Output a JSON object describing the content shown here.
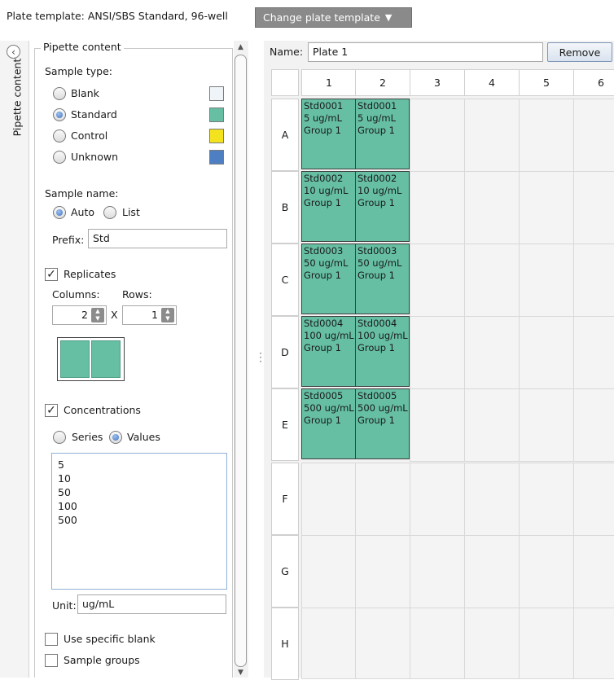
{
  "top_bar": {
    "plate_template_label": "Plate template:  ANSI/SBS Standard, 96-well",
    "change_button_label": "Change plate template",
    "change_button_icon": "caret-down-icon"
  },
  "side_tab": {
    "label": "Pipette content"
  },
  "pipette_panel": {
    "title": "Pipette content",
    "sample_type_label": "Sample type:",
    "sample_types": [
      {
        "label": "Blank",
        "selected": false,
        "color": "#eef4f7"
      },
      {
        "label": "Standard",
        "selected": true,
        "color": "#66bfa3"
      },
      {
        "label": "Control",
        "selected": false,
        "color": "#f3e31f"
      },
      {
        "label": "Unknown",
        "selected": false,
        "color": "#4e7fc2"
      }
    ],
    "sample_name_label": "Sample name:",
    "name_modes": [
      {
        "label": "Auto",
        "selected": true
      },
      {
        "label": "List",
        "selected": false
      }
    ],
    "prefix_label": "Prefix:",
    "prefix_value": "Std",
    "replicates": {
      "label": "Replicates",
      "checked": true,
      "columns_label": "Columns:",
      "rows_label": "Rows:",
      "columns_value": "2",
      "rows_value": "1",
      "times_label": "X"
    },
    "concentrations": {
      "label": "Concentrations",
      "checked": true,
      "modes": [
        {
          "label": "Series",
          "selected": false
        },
        {
          "label": "Values",
          "selected": true
        }
      ],
      "values": [
        "5",
        "10",
        "50",
        "100",
        "500"
      ],
      "unit_label": "Unit:",
      "unit_value": "ug/mL"
    },
    "use_specific_blank": {
      "label": "Use specific blank",
      "checked": false
    },
    "sample_groups": {
      "label": "Sample groups",
      "checked": false
    }
  },
  "plate": {
    "name_label": "Name:",
    "name_value": "Plate 1",
    "remove_label": "Remove",
    "columns": [
      "1",
      "2",
      "3",
      "4",
      "5",
      "6"
    ],
    "rows": [
      "A",
      "B",
      "C",
      "D",
      "E",
      "F",
      "G",
      "H"
    ],
    "filled_wells": [
      {
        "row": 0,
        "col": 0,
        "lines": [
          "Std0001",
          "5 ug/mL",
          "Group 1"
        ]
      },
      {
        "row": 0,
        "col": 1,
        "lines": [
          "Std0001",
          "5 ug/mL",
          "Group 1"
        ]
      },
      {
        "row": 1,
        "col": 0,
        "lines": [
          "Std0002",
          "10 ug/mL",
          "Group 1"
        ]
      },
      {
        "row": 1,
        "col": 1,
        "lines": [
          "Std0002",
          "10 ug/mL",
          "Group 1"
        ]
      },
      {
        "row": 2,
        "col": 0,
        "lines": [
          "Std0003",
          "50 ug/mL",
          "Group 1"
        ]
      },
      {
        "row": 2,
        "col": 1,
        "lines": [
          "Std0003",
          "50 ug/mL",
          "Group 1"
        ]
      },
      {
        "row": 3,
        "col": 0,
        "lines": [
          "Std0004",
          "100 ug/mL",
          "Group 1"
        ]
      },
      {
        "row": 3,
        "col": 1,
        "lines": [
          "Std0004",
          "100 ug/mL",
          "Group 1"
        ]
      },
      {
        "row": 4,
        "col": 0,
        "lines": [
          "Std0005",
          "500 ug/mL",
          "Group 1"
        ]
      },
      {
        "row": 4,
        "col": 1,
        "lines": [
          "Std0005",
          "500 ug/mL",
          "Group 1"
        ]
      }
    ]
  }
}
